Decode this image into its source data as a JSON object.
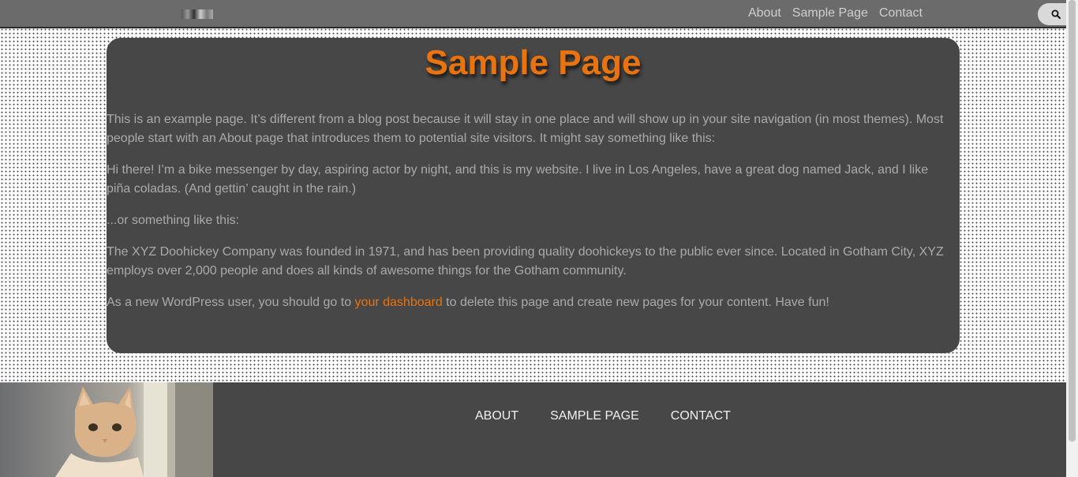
{
  "header": {
    "nav": [
      "About",
      "Sample Page",
      "Contact"
    ],
    "search_icon": "search-icon"
  },
  "page": {
    "title": "Sample Page",
    "paragraphs": [
      "This is an example page. It’s different from a blog post because it will stay in one place and will show up in your site navigation (in most themes). Most people start with an About page that introduces them to potential site visitors. It might say something like this:",
      "Hi there! I’m a bike messenger by day, aspiring actor by night, and this is my website. I live in Los Angeles, have a great dog named Jack, and I like piña coladas. (And gettin’ caught in the rain.)",
      "...or something like this:",
      "The XYZ Doohickey Company was founded in 1971, and has been providing quality doohickeys to the public ever since. Located in Gotham City, XYZ employs over 2,000 people and does all kinds of awesome things for the Gotham community."
    ],
    "last_paragraph": {
      "before": "As a new WordPress user, you should go to ",
      "link": "your dashboard",
      "after": " to delete this page and create new pages for your content. Have fun!"
    }
  },
  "footer": {
    "nav": [
      "About",
      "Sample Page",
      "Contact"
    ],
    "image": "cat-photo"
  },
  "colors": {
    "accent": "#e8730f",
    "card_bg": "#474747",
    "topbar_bg": "#6b6b6b",
    "body_text": "#aaaaaa"
  }
}
